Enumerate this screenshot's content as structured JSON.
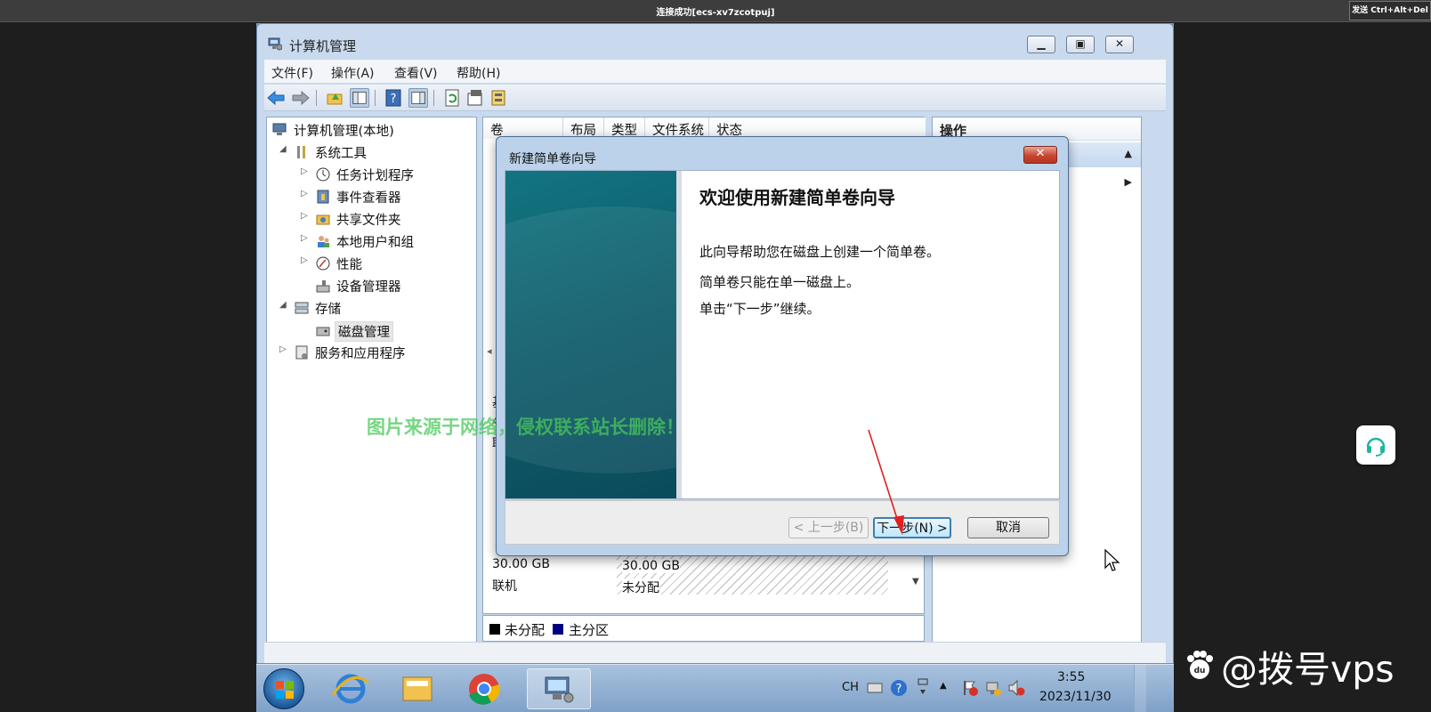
{
  "session": {
    "title": "连接成功[ecs-xv7zcotpuj]",
    "send_cad": "发送 Ctrl+Alt+Del"
  },
  "window": {
    "title": "计算机管理",
    "menu": [
      "文件(F)",
      "操作(A)",
      "查看(V)",
      "帮助(H)"
    ]
  },
  "tree": {
    "root": "计算机管理(本地)",
    "system_tools": "系统工具",
    "task_scheduler": "任务计划程序",
    "event_viewer": "事件查看器",
    "shared_folders": "共享文件夹",
    "local_users": "本地用户和组",
    "performance": "性能",
    "device_manager": "设备管理器",
    "storage": "存储",
    "disk_management": "磁盘管理",
    "services_apps": "服务和应用程序"
  },
  "volume_columns": [
    "卷",
    "布局",
    "类型",
    "文件系统",
    "状态"
  ],
  "disk": {
    "size_left": "30.00 GB",
    "status_left": "联机",
    "size_right": "30.00 GB",
    "status_right": "未分配",
    "frag_1": "基",
    "frag_2": "4",
    "frag_3": "联"
  },
  "legend": {
    "unallocated": "未分配",
    "primary": "主分区",
    "unallocated_color": "#000000",
    "primary_color": "#000080"
  },
  "actions": {
    "header": "操作"
  },
  "wizard": {
    "title": "新建简单卷向导",
    "heading": "欢迎使用新建简单卷向导",
    "line1": "此向导帮助您在磁盘上创建一个简单卷。",
    "line2": "简单卷只能在单一磁盘上。",
    "line3": "单击“下一步”继续。",
    "back": "< 上一步(B)",
    "next": "下一步(N) >",
    "cancel": "取消"
  },
  "tray": {
    "lang": "CH",
    "time": "3:55",
    "date": "2023/11/30"
  },
  "watermark": "图片来源于网络，侵权联系站长删除！",
  "brand": "@拨号vps"
}
